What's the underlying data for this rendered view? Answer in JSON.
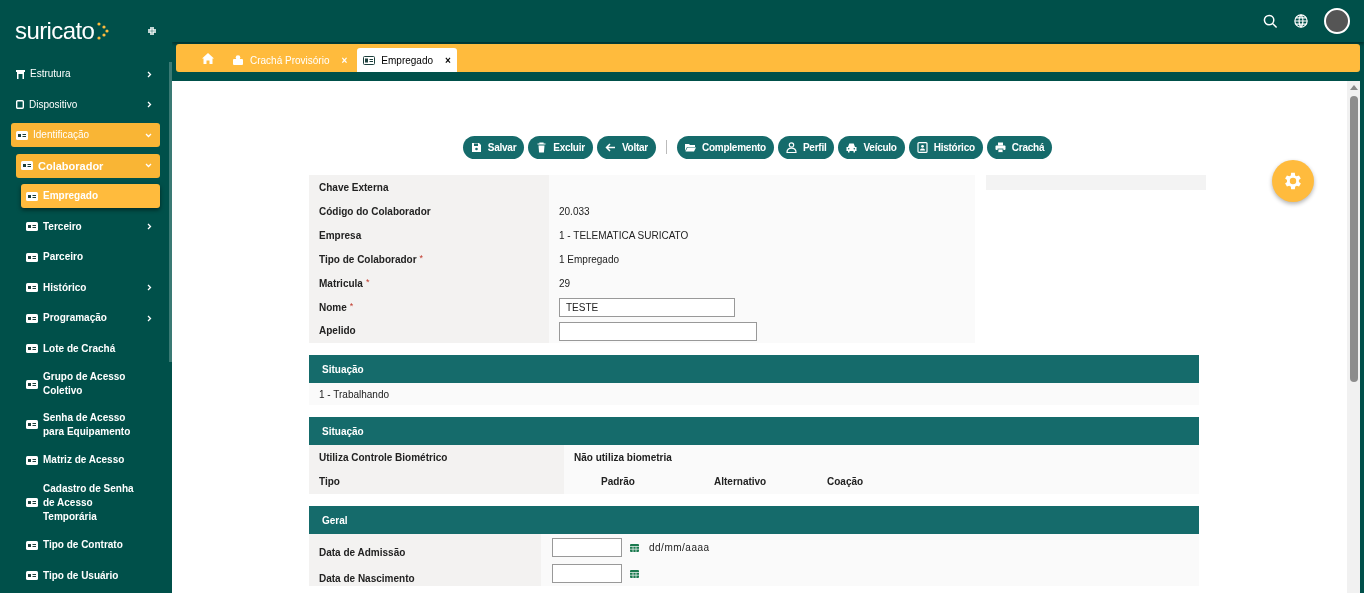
{
  "sidebar": {
    "logo": "suricato",
    "items": [
      {
        "label": "Estrutura",
        "selected": false,
        "expanded": false
      },
      {
        "label": "Dispositivo",
        "selected": false,
        "expanded": false
      },
      {
        "label": "Identificação",
        "selected": false,
        "expanded": true,
        "children": [
          {
            "label": "Colaborador",
            "selected": false,
            "expanded": true,
            "children": [
              {
                "label": "Empregado",
                "selected": true
              },
              {
                "label": "Terceiro",
                "selected": false,
                "expanded": false
              },
              {
                "label": "Parceiro",
                "selected": false
              },
              {
                "label": "Histórico",
                "selected": false,
                "expanded": false
              },
              {
                "label": "Programação",
                "selected": false,
                "expanded": false
              },
              {
                "label": "Lote de Crachá",
                "selected": false
              },
              {
                "label": "Grupo de Acesso Coletivo",
                "selected": false
              },
              {
                "label": "Senha de Acesso para Equipamento",
                "selected": false
              },
              {
                "label": "Matriz de Acesso",
                "selected": false
              },
              {
                "label": "Cadastro de Senha de Acesso Temporária",
                "selected": false
              },
              {
                "label": "Tipo de Contrato",
                "selected": false
              },
              {
                "label": "Tipo de Usuário",
                "selected": false
              }
            ]
          }
        ]
      }
    ]
  },
  "tabs": [
    {
      "label": "Crachá Provisório",
      "selected": false,
      "close": "×"
    },
    {
      "label": "Empregado",
      "selected": true,
      "close": "×"
    }
  ],
  "toolbar": [
    {
      "label": "Salvar",
      "kind": "save"
    },
    {
      "label": "Excluir",
      "kind": "delete"
    },
    {
      "label": "Voltar",
      "kind": "back"
    },
    {
      "kind": "divider"
    },
    {
      "label": "Complemento",
      "kind": "folder"
    },
    {
      "label": "Perfil",
      "kind": "user"
    },
    {
      "label": "Veículo",
      "kind": "car"
    },
    {
      "label": "Histórico",
      "kind": "history"
    },
    {
      "label": "Crachá",
      "kind": "print"
    }
  ],
  "fields": [
    {
      "label": "Chave Externa",
      "kind": "text"
    },
    {
      "label": "Código do Colaborador",
      "kind": "text",
      "value": "20.033"
    },
    {
      "label": "Empresa",
      "kind": "text",
      "value": "1 - TELEMATICA SURICATO"
    },
    {
      "label": "Tipo de Colaborador",
      "required_mark": "*",
      "kind": "text",
      "value": "1 Empregado"
    },
    {
      "label": "Matricula",
      "required_mark": "*",
      "kind": "text",
      "value": "29"
    },
    {
      "label": "Nome",
      "required_mark": "*",
      "kind": "input",
      "value": "TESTE"
    },
    {
      "label": "Apelido",
      "kind": "input"
    }
  ],
  "situacao": {
    "title": "Situação",
    "value": "1 - Trabalhando"
  },
  "biometria": {
    "title": "Situação",
    "rows": [
      {
        "label": "Utiliza Controle Biométrico",
        "value": "Não utiliza biometria"
      },
      {
        "label": "Tipo",
        "options": [
          "Padrão",
          "Alternativo",
          "Coação"
        ]
      }
    ]
  },
  "geral": {
    "title": "Geral",
    "rows": [
      {
        "label": "Data de Admissão",
        "placeholder": "dd/mm/aaaa"
      },
      {
        "label": "Data de Nascimento"
      }
    ]
  }
}
